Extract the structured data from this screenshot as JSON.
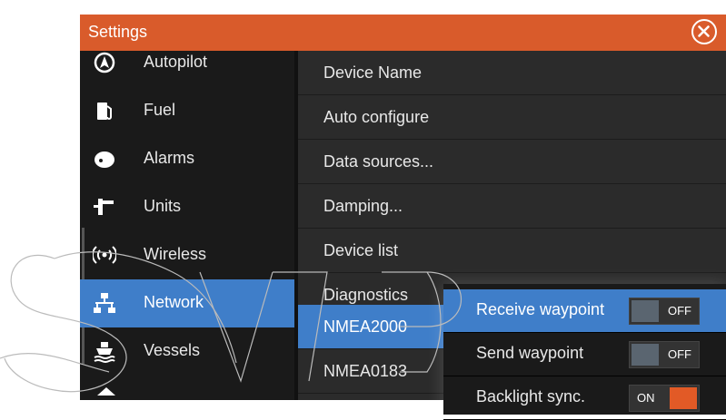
{
  "window": {
    "title": "Settings"
  },
  "sidebar": {
    "items": [
      {
        "label": "Autopilot",
        "icon": "autopilot-icon"
      },
      {
        "label": "Fuel",
        "icon": "fuel-pump-icon"
      },
      {
        "label": "Alarms",
        "icon": "alarm-bell-icon"
      },
      {
        "label": "Units",
        "icon": "units-icon"
      },
      {
        "label": "Wireless",
        "icon": "wireless-icon"
      },
      {
        "label": "Network",
        "icon": "network-icon",
        "selected": true
      },
      {
        "label": "Vessels",
        "icon": "vessel-icon"
      }
    ]
  },
  "main": {
    "items": [
      {
        "label": "Device Name"
      },
      {
        "label": "Auto configure"
      },
      {
        "label": "Data sources..."
      },
      {
        "label": "Damping..."
      },
      {
        "label": "Device list"
      },
      {
        "label": "Diagnostics"
      },
      {
        "label": "NMEA2000",
        "selected": true
      },
      {
        "label": "NMEA0183"
      }
    ]
  },
  "popup": {
    "rows": [
      {
        "label": "Receive waypoint",
        "state": "OFF",
        "selected": true
      },
      {
        "label": "Send waypoint",
        "state": "OFF"
      },
      {
        "label": "Backlight sync.",
        "state": "ON"
      }
    ]
  },
  "colors": {
    "accent_orange": "#d95b2b",
    "selection_blue": "#3f7ec9",
    "toggle_on": "#e25a26",
    "toggle_off": "#5a6570"
  }
}
